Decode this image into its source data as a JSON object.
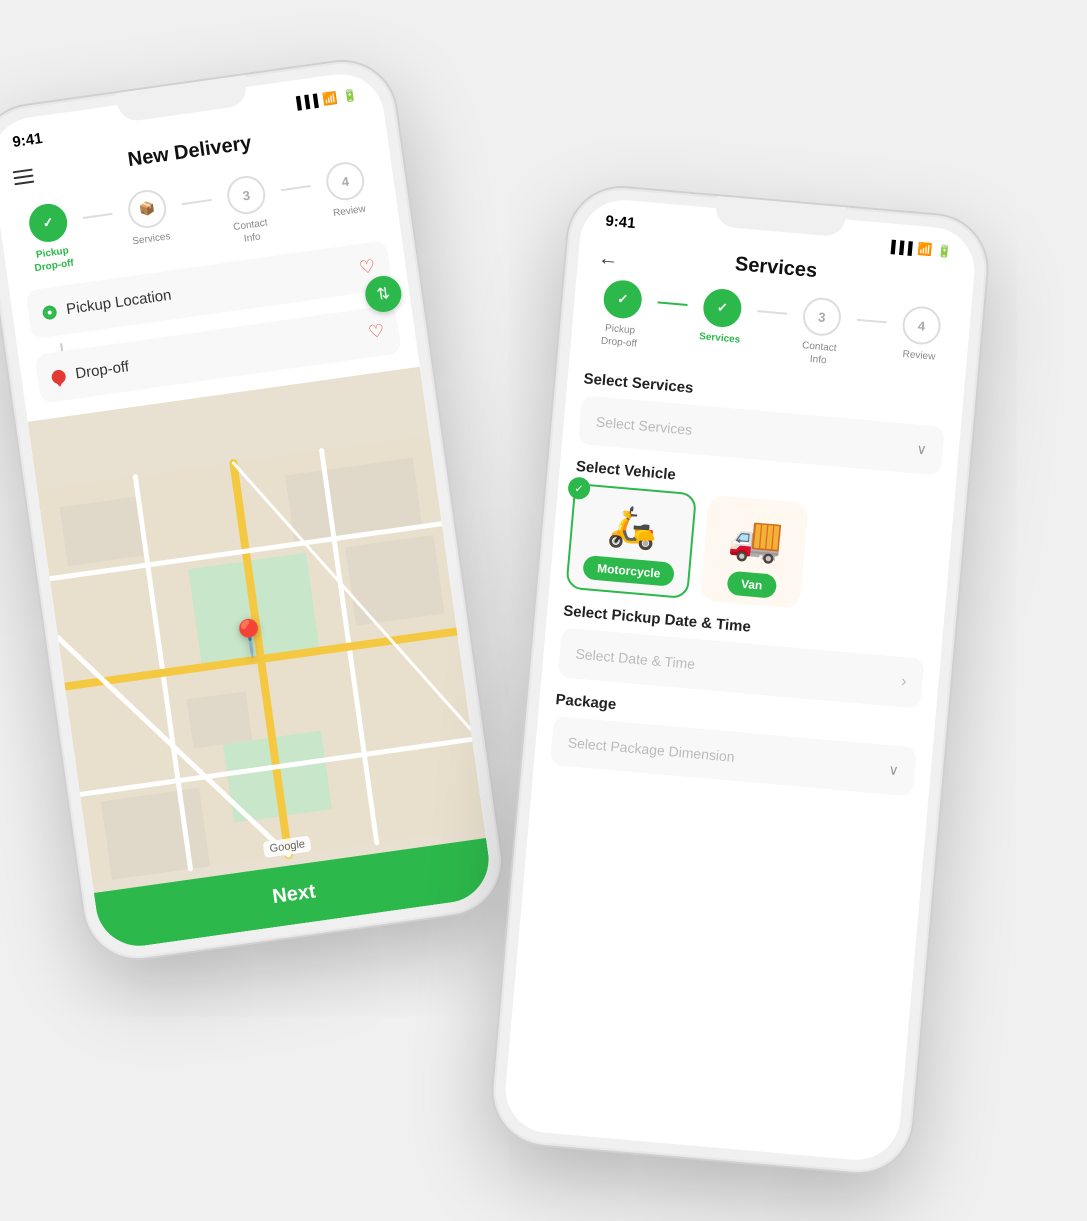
{
  "scene": {
    "background": "#f2f2f2"
  },
  "phone1": {
    "status": {
      "time": "9:41",
      "signal": "●●●",
      "wifi": "wifi",
      "battery": "battery"
    },
    "title": "New Delivery",
    "steps": [
      {
        "id": 1,
        "label": "Pickup\nDrop-off",
        "icon": "📍",
        "state": "completed"
      },
      {
        "id": 2,
        "label": "Services",
        "icon": "📦",
        "state": "default"
      },
      {
        "id": 3,
        "label": "Contact\nInfo",
        "icon": "👤",
        "state": "default"
      },
      {
        "id": 4,
        "label": "Review",
        "icon": "✓",
        "state": "default"
      }
    ],
    "locations": {
      "pickup": {
        "placeholder": "Pickup Location",
        "dot": "green"
      },
      "dropoff": {
        "placeholder": "Drop-off",
        "dot": "red"
      }
    },
    "map": {
      "pin_label": "📍",
      "google_label": "Google"
    },
    "next_button": "Next"
  },
  "phone2": {
    "status": {
      "time": "9:41",
      "signal": "●●●",
      "wifi": "wifi",
      "battery": "battery"
    },
    "title": "Services",
    "back_icon": "←",
    "steps": [
      {
        "id": 1,
        "label": "Pickup\nDrop-off",
        "icon": "📍",
        "state": "completed"
      },
      {
        "id": 2,
        "label": "Services",
        "icon": "📦",
        "state": "completed"
      },
      {
        "id": 3,
        "label": "Contact\nInfo",
        "icon": "👤",
        "state": "default"
      },
      {
        "id": 4,
        "label": "Review",
        "icon": "✓",
        "state": "default"
      }
    ],
    "sections": {
      "select_services": {
        "label": "Select Services",
        "placeholder": "Select Services"
      },
      "select_vehicle": {
        "label": "Select Vehicle",
        "vehicles": [
          {
            "name": "Motorcycle",
            "emoji": "🛵",
            "selected": true
          },
          {
            "name": "Van",
            "emoji": "🚚",
            "selected": false
          }
        ]
      },
      "select_datetime": {
        "label": "Select Pickup Date & Time",
        "placeholder": "Select Date & Time"
      },
      "package": {
        "label": "Package",
        "placeholder": "Select Package Dimension"
      }
    }
  }
}
